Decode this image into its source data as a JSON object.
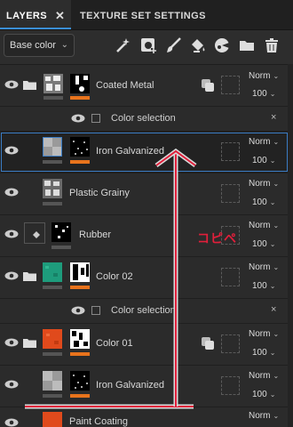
{
  "tabs": {
    "layers": "LAYERS",
    "close": "✕",
    "texture_set_settings": "TEXTURE SET SETTINGS"
  },
  "toolbar": {
    "channel_select": "Base color",
    "icons": [
      "magic-wand-icon",
      "add-mask-icon",
      "paint-brush-icon",
      "fill-bucket-icon",
      "smart-material-icon",
      "folder-icon",
      "trash-icon"
    ]
  },
  "layers": [
    {
      "name": "Coated Metal",
      "blend": "Norm",
      "opacity": "100",
      "folder": true
    },
    {
      "name": "Color selection",
      "sub": true
    },
    {
      "name": "Iron Galvanized",
      "blend": "Norm",
      "opacity": "100",
      "selected": true
    },
    {
      "name": "Plastic Grainy",
      "blend": "Norm",
      "opacity": "100"
    },
    {
      "name": "Rubber",
      "blend": "Norm",
      "opacity": "100"
    },
    {
      "name": "Color 02",
      "blend": "Norm",
      "opacity": "100",
      "folder": true
    },
    {
      "name": "Color selection",
      "sub": true
    },
    {
      "name": "Color 01",
      "blend": "Norm",
      "opacity": "100",
      "folder": true
    },
    {
      "name": "Iron Galvanized",
      "blend": "Norm",
      "opacity": "100"
    },
    {
      "name": "Paint Coating",
      "blend": "Norm"
    }
  ],
  "annotation": {
    "text": "コピペ",
    "color": "#e01f3b"
  },
  "colors": {
    "accent_blue": "#3b7cc4",
    "orange_bar": "#e8731c",
    "teal_thumb": "#1e9c7c",
    "red_thumb": "#e04a1c"
  }
}
